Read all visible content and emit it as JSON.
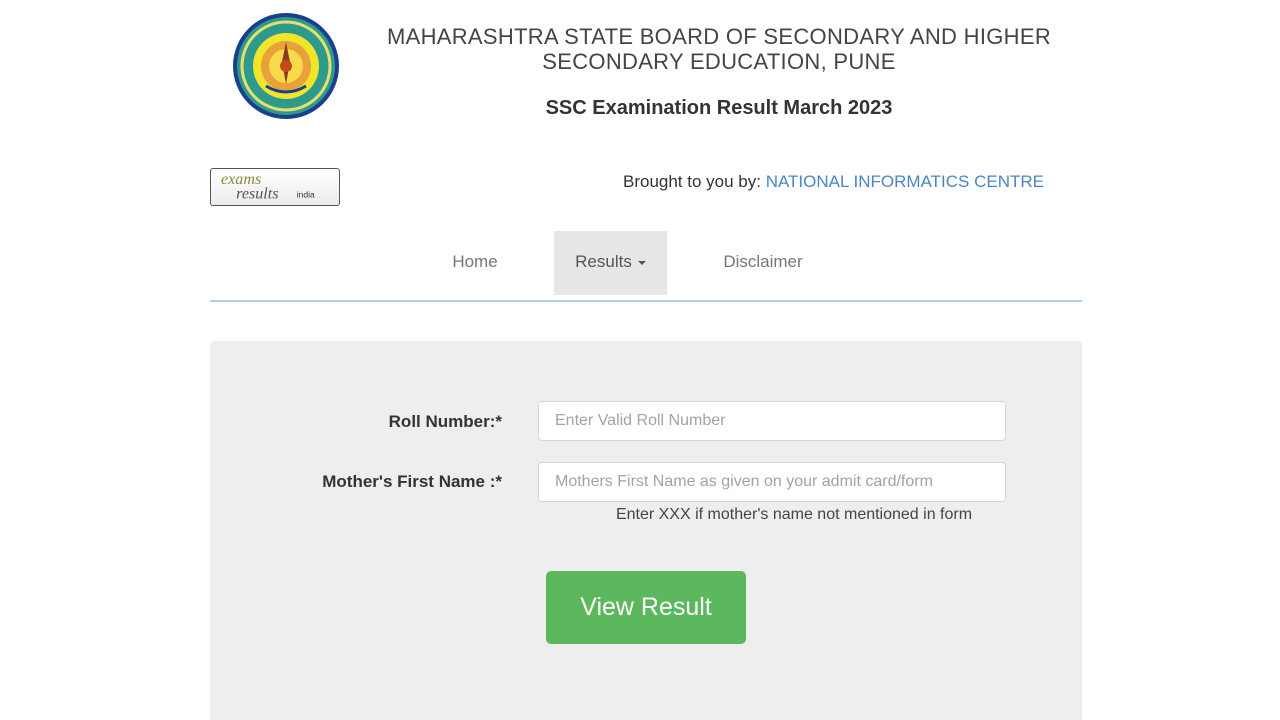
{
  "header": {
    "board_line1": "MAHARASHTRA STATE BOARD OF SECONDARY AND HIGHER",
    "board_line2": "SECONDARY EDUCATION, PUNE",
    "exam_title": "SSC Examination Result March 2023"
  },
  "subheader": {
    "exams_logo_text_top": "exams",
    "exams_logo_text_bottom": "results",
    "exams_logo_text_small": "india",
    "brought_by_label": "Brought to you by: ",
    "brought_by_org": "NATIONAL INFORMATICS CENTRE"
  },
  "nav": {
    "items": [
      {
        "label": "Home"
      },
      {
        "label": "Results"
      },
      {
        "label": "Disclaimer"
      }
    ]
  },
  "form": {
    "roll_label": "Roll Number:*",
    "roll_placeholder": "Enter Valid Roll Number",
    "roll_value": "",
    "mother_label": "Mother's First Name :*",
    "mother_placeholder": "Mothers First Name as given on your admit card/form",
    "mother_value": "",
    "help_text": "Enter XXX if mother's name not mentioned in form",
    "submit_label": "View Result"
  },
  "colors": {
    "button": "#5cb85c",
    "link": "#4a86c5",
    "panel": "#eeeeee",
    "nav_line": "#a9d3ea"
  },
  "icons": {
    "board_logo": "board-seal-logo",
    "exams_logo": "examsresults-india-logo",
    "dropdown": "caret-down-icon"
  }
}
